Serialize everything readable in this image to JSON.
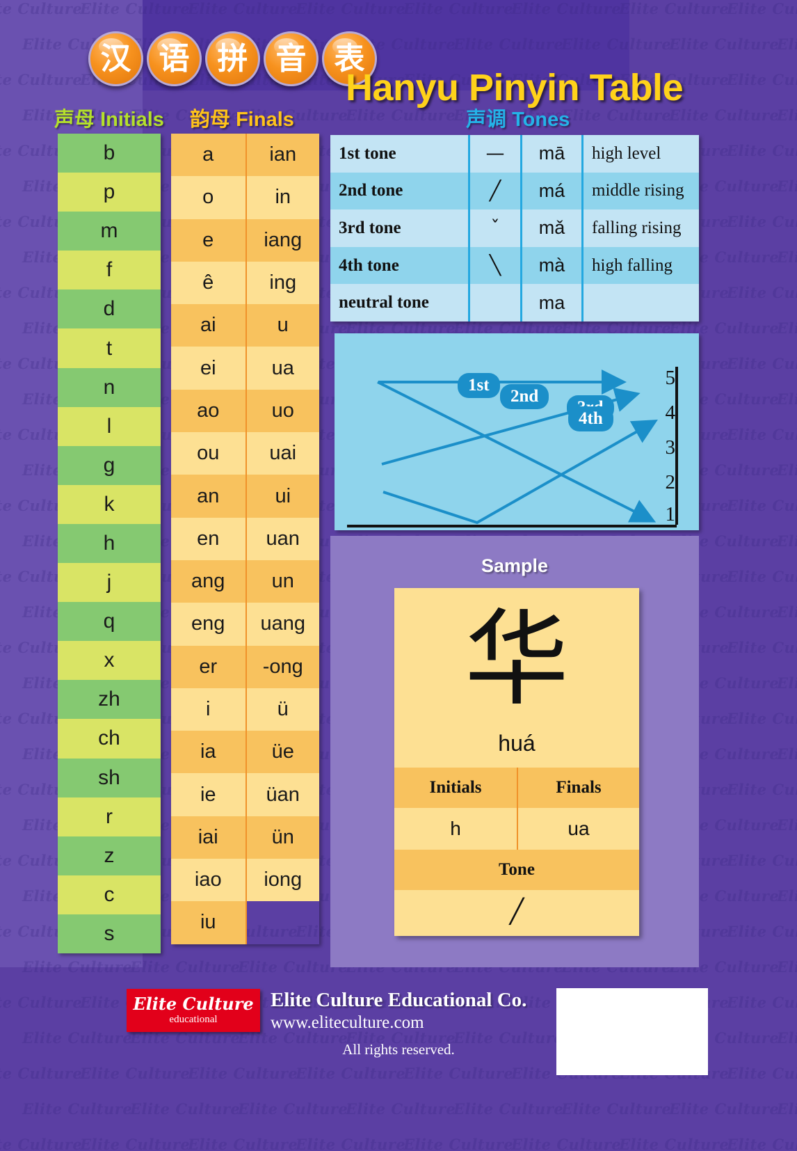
{
  "title": {
    "chinese_chars": [
      "汉",
      "语",
      "拼",
      "音",
      "表"
    ],
    "english": "Hanyu Pinyin Table"
  },
  "sections": {
    "initials_heading_cn": "声母",
    "initials_heading_en": "Initials",
    "finals_heading_cn": "韵母",
    "finals_heading_en": "Finals",
    "tones_heading_cn": "声调",
    "tones_heading_en": "Tones",
    "sample_heading": "Sample"
  },
  "initials": [
    "b",
    "p",
    "m",
    "f",
    "d",
    "t",
    "n",
    "l",
    "g",
    "k",
    "h",
    "j",
    "q",
    "x",
    "zh",
    "ch",
    "sh",
    "r",
    "z",
    "c",
    "s"
  ],
  "finals_left": [
    "a",
    "o",
    "e",
    "ê",
    "ai",
    "ei",
    "ao",
    "ou",
    "an",
    "en",
    "ang",
    "eng",
    "er",
    "i",
    "ia",
    "ie",
    "iai",
    "iao",
    "iu"
  ],
  "finals_right": [
    "ian",
    "in",
    "iang",
    "ing",
    "u",
    "ua",
    "uo",
    "uai",
    "ui",
    "uan",
    "un",
    "uang",
    "-ong",
    "ü",
    "üe",
    "üan",
    "ün",
    "iong"
  ],
  "tones": [
    {
      "name": "1st tone",
      "mark": "—",
      "syllable": "mā",
      "description": "high level"
    },
    {
      "name": "2nd tone",
      "mark": "╱",
      "syllable": "má",
      "description": "middle rising"
    },
    {
      "name": "3rd tone",
      "mark": "ˇ",
      "syllable": "mǎ",
      "description": "falling rising"
    },
    {
      "name": "4th tone",
      "mark": "╲",
      "syllable": "mà",
      "description": "high falling"
    },
    {
      "name": "neutral tone",
      "mark": "",
      "syllable": "ma",
      "description": ""
    }
  ],
  "tone_graph": {
    "scale_labels": [
      "5",
      "4",
      "3",
      "2",
      "1"
    ],
    "badges": [
      "1st",
      "2nd",
      "3rd",
      "4th"
    ],
    "contours": [
      {
        "name": "1st",
        "from": 5,
        "to": 5
      },
      {
        "name": "2nd",
        "from": 3,
        "to": 5
      },
      {
        "name": "3rd",
        "from": 2,
        "via": 1,
        "to": 4
      },
      {
        "name": "4th",
        "from": 5,
        "to": 1
      }
    ]
  },
  "sample": {
    "character": "华",
    "pinyin": "huá",
    "initials_label": "Initials",
    "finals_label": "Finals",
    "initial_value": "h",
    "final_value": "ua",
    "tone_label": "Tone",
    "tone_mark": "╱"
  },
  "footer": {
    "logo_main": "Elite Culture",
    "logo_sub": "educational",
    "company": "Elite Culture Educational Co.",
    "website": "www.eliteculture.com",
    "rights": "All rights reserved."
  },
  "watermark": {
    "text": "Elite Culture"
  },
  "colors": {
    "background_purple": "#5b3fa3",
    "background_purple_light": "#6a51b0",
    "initials_green_a": "#85c971",
    "initials_green_b": "#d9e465",
    "finals_orange_a": "#f8c25e",
    "finals_orange_b": "#fde093",
    "tones_blue_a": "#c3e4f4",
    "tones_blue_b": "#8fd4ec",
    "accent_cyan": "#24a8e0",
    "title_yellow": "#ffd21a",
    "logo_red": "#e2001a"
  }
}
